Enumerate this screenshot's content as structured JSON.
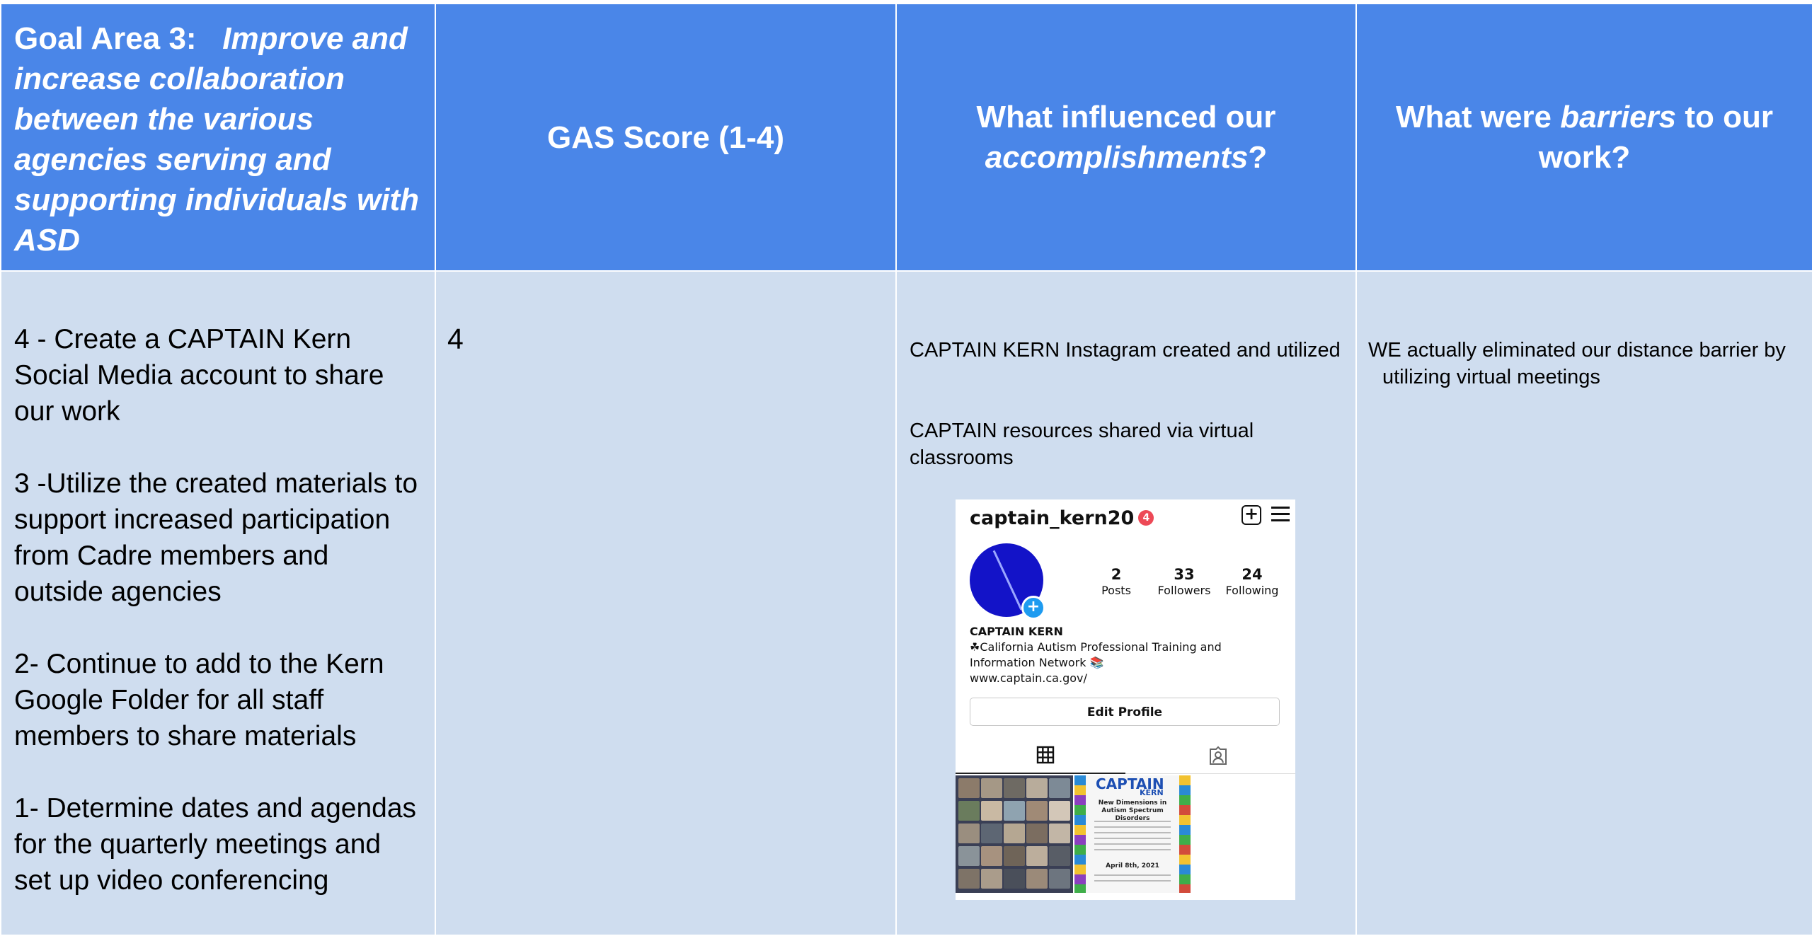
{
  "header": {
    "goal_prefix": "Goal Area 3:",
    "goal_text": "Improve and increase collaboration between the various agencies serving and supporting individuals with ASD",
    "gas_score": "GAS Score (1-4)",
    "influenced_prefix": "What influenced our",
    "influenced_em": "accomplishments",
    "influenced_suffix": "?",
    "barriers_prefix": "What were",
    "barriers_em": "barriers",
    "barriers_suffix": "to our work?"
  },
  "body": {
    "steps": [
      "4 - Create a CAPTAIN Kern Social Media account to share our work",
      "3 -Utilize the created materials to support increased participation from Cadre members and outside agencies",
      "2- Continue to add to the Kern Google Folder for all staff members to share materials",
      "1- Determine dates and agendas for the quarterly meetings and set up video conferencing"
    ],
    "score": "4",
    "influences": [
      "CAPTAIN KERN Instagram created and utilized",
      "CAPTAIN resources shared via virtual classrooms"
    ],
    "barriers": [
      "WE actually eliminated our distance barrier by utilizing virtual meetings"
    ]
  },
  "instagram": {
    "username": "captain_kern20",
    "notifications": "4",
    "stats": [
      {
        "value": "2",
        "label": "Posts"
      },
      {
        "value": "33",
        "label": "Followers"
      },
      {
        "value": "24",
        "label": "Following"
      }
    ],
    "bio_name": "CAPTAIN KERN",
    "bio_line": "☘California Autism Professional Training and Information Network 📚",
    "bio_link": "www.captain.ca.gov/",
    "edit_profile": "Edit Profile",
    "post_title": "CAPTAIN",
    "post_badge": "KERN",
    "post_heading": "New Dimensions in Autism Spectrum Disorders",
    "post_date": "April 8th, 2021",
    "colors": {
      "blue_header": "#4a86e8",
      "body_bg": "#cfddef",
      "avatar": "#1313c8",
      "notif": "#ed4956"
    }
  }
}
